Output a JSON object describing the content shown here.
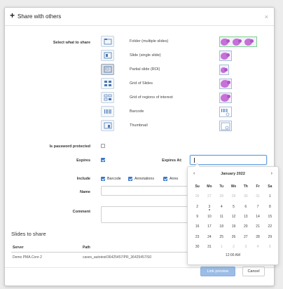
{
  "dialog": {
    "title": "Share with others",
    "close": "×"
  },
  "select_label": "Select what to share",
  "share_options": [
    {
      "label": "Folder (multiple slides)",
      "icon": "folder-icon"
    },
    {
      "label": "Slide (single slide)",
      "icon": "slide-icon"
    },
    {
      "label": "Partial slide (ROI)",
      "icon": "partial-slide-icon"
    },
    {
      "label": "Grid of Slides",
      "icon": "grid-slides-icon"
    },
    {
      "label": "Grid of regions of interest",
      "icon": "grid-roi-icon"
    },
    {
      "label": "Barcode",
      "icon": "barcode-icon"
    },
    {
      "label": "Thumbnail",
      "icon": "thumbnail-icon"
    }
  ],
  "password": {
    "label": "Is password protected",
    "checked": false
  },
  "expires": {
    "label": "Expires",
    "checked": true,
    "at_label": "Expires At:",
    "value": ""
  },
  "include": {
    "label": "Include",
    "items": [
      {
        "label": "Barcode",
        "checked": true
      },
      {
        "label": "Annotations",
        "checked": true
      },
      {
        "label": "Anno",
        "checked": true
      }
    ]
  },
  "name": {
    "label": "Name",
    "value": ""
  },
  "comment": {
    "label": "Comment",
    "value": ""
  },
  "slides": {
    "title": "Slides to share",
    "columns": [
      "Server",
      "Path"
    ],
    "rows": [
      [
        "Demo PMA.Core 2",
        "cases_autotest/36425457/PR_36425457/S0"
      ]
    ]
  },
  "buttons": {
    "primary": "Link preview",
    "cancel": "Cancel"
  },
  "calendar": {
    "prev": "‹",
    "next": "›",
    "month": "January 2022",
    "weekdays": [
      "Su",
      "Mo",
      "Tu",
      "We",
      "Th",
      "Fr",
      "Sa"
    ],
    "weeks": [
      [
        "26",
        "27",
        "28",
        "29",
        "30",
        "31",
        "1"
      ],
      [
        "2",
        "3",
        "4",
        "5",
        "6",
        "7",
        "8"
      ],
      [
        "9",
        "10",
        "11",
        "12",
        "13",
        "14",
        "15"
      ],
      [
        "16",
        "17",
        "18",
        "19",
        "20",
        "21",
        "22"
      ],
      [
        "23",
        "24",
        "25",
        "26",
        "27",
        "28",
        "29"
      ],
      [
        "30",
        "31",
        "1",
        "2",
        "3",
        "4",
        "5"
      ]
    ],
    "muted_first_week": 6,
    "muted_last_week_from": 2,
    "today": {
      "week": 1,
      "day": 1
    },
    "time": "12:00 AM"
  },
  "colors": {
    "accent": "#3a76c8",
    "primary_button": "#9bbde6",
    "thumb_fill": "#c770d8"
  }
}
